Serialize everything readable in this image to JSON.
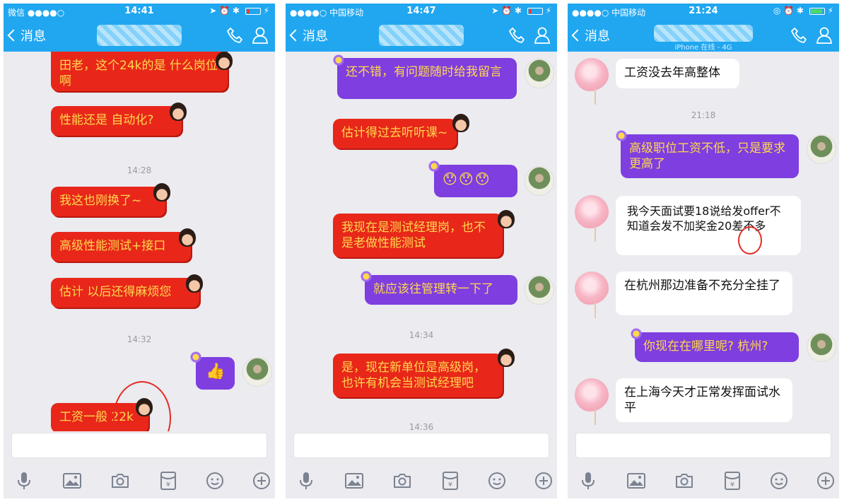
{
  "panels": [
    {
      "status": {
        "left": "微信 ●●●●○",
        "time": "14:41",
        "battery": "low"
      },
      "nav": {
        "back_label": "消息",
        "subtitle": ""
      },
      "timestamps": [
        "14:28",
        "14:32"
      ],
      "messages": [
        "田老，这个24k的是 什么岗位啊",
        "性能还是 自动化?",
        "我这也刚换了~",
        "高级性能测试+接口",
        "估计 以后还得麻烦您",
        "👍",
        "工资一般 22k"
      ]
    },
    {
      "status": {
        "left": "●●●●○ 中国移动",
        "time": "14:47",
        "battery": "low"
      },
      "nav": {
        "back_label": "消息",
        "subtitle": ""
      },
      "timestamps": [
        "14:34",
        "14:36"
      ],
      "messages": [
        "还不错，有问题随时给我留言",
        "估计得过去听听课~",
        "😯😯😯",
        "我现在是测试经理岗，也不是老做性能测试",
        "就应该往管理转一下了",
        "是，现在新单位是高级岗，也许有机会当测试经理吧"
      ]
    },
    {
      "status": {
        "left": "●●●●○ 中国移动",
        "time": "21:24",
        "battery": "good"
      },
      "nav": {
        "back_label": "消息",
        "subtitle": "iPhone 在线 - 4G"
      },
      "timestamps": [
        "21:18"
      ],
      "messages": [
        "工资没去年高整体",
        "高级职位工资不低，只是要求更高了",
        "我今天面试要18说给发offer不知道会发不加奖金20差不多",
        "在杭州那边准备不充分全挂了",
        "你现在在哪里呢? 杭州?",
        "在上海今天才正常发挥面试水平"
      ]
    }
  ],
  "colors": {
    "header": "#20a7f0",
    "chat_bg": "#ebebf0",
    "red_bubble": "#e8271a",
    "purple_bubble": "#7e3ee0",
    "bubble_text": "#ffd84d",
    "annotation_circle": "#e52a22"
  },
  "toolbar_icons": [
    "microphone-icon",
    "image-icon",
    "camera-icon",
    "red-packet-icon",
    "emoji-icon",
    "plus-icon"
  ]
}
